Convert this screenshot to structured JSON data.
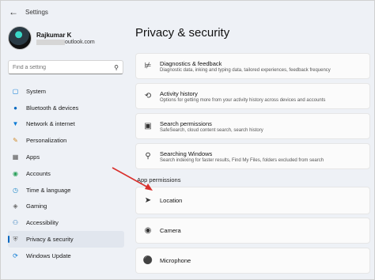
{
  "window": {
    "title": "Settings"
  },
  "profile": {
    "name": "Rajkumar K",
    "email_suffix": "outlook.com"
  },
  "search": {
    "placeholder": "Find a setting"
  },
  "sidebar": {
    "items": [
      {
        "label": "System",
        "icon": "monitor-icon",
        "color": "#0078d4",
        "active": false
      },
      {
        "label": "Bluetooth & devices",
        "icon": "bluetooth-icon",
        "color": "#0067c0",
        "active": false
      },
      {
        "label": "Network & internet",
        "icon": "wifi-icon",
        "color": "#0a7ad4",
        "active": false
      },
      {
        "label": "Personalization",
        "icon": "brush-icon",
        "color": "#d08a2a",
        "active": false
      },
      {
        "label": "Apps",
        "icon": "apps-icon",
        "color": "#555555",
        "active": false
      },
      {
        "label": "Accounts",
        "icon": "person-icon",
        "color": "#2aa05a",
        "active": false
      },
      {
        "label": "Time & language",
        "icon": "globe-clock-icon",
        "color": "#1e88c8",
        "active": false
      },
      {
        "label": "Gaming",
        "icon": "gamepad-icon",
        "color": "#6b6b6b",
        "active": false
      },
      {
        "label": "Accessibility",
        "icon": "accessibility-icon",
        "color": "#1a6fb5",
        "active": false
      },
      {
        "label": "Privacy & security",
        "icon": "shield-icon",
        "color": "#6b6b6b",
        "active": true
      },
      {
        "label": "Windows Update",
        "icon": "update-icon",
        "color": "#0a7ad4",
        "active": false
      }
    ]
  },
  "main": {
    "title": "Privacy & security",
    "cards": [
      {
        "title": "Diagnostics & feedback",
        "subtitle": "Diagnostic data, inking and typing data, tailored experiences, feedback frequency",
        "icon": "diagnostics-icon"
      },
      {
        "title": "Activity history",
        "subtitle": "Options for getting more from your activity history across devices and accounts",
        "icon": "history-icon"
      },
      {
        "title": "Search permissions",
        "subtitle": "SafeSearch, cloud content search, search history",
        "icon": "search-permissions-icon"
      },
      {
        "title": "Searching Windows",
        "subtitle": "Search indexing for faster results, Find My Files, folders excluded from search",
        "icon": "search-windows-icon"
      }
    ],
    "section_label": "App permissions",
    "permissions": [
      {
        "title": "Location",
        "icon": "location-icon"
      },
      {
        "title": "Camera",
        "icon": "camera-icon"
      },
      {
        "title": "Microphone",
        "icon": "microphone-icon"
      }
    ]
  },
  "annotation": {
    "arrow_color": "#d9302c"
  }
}
